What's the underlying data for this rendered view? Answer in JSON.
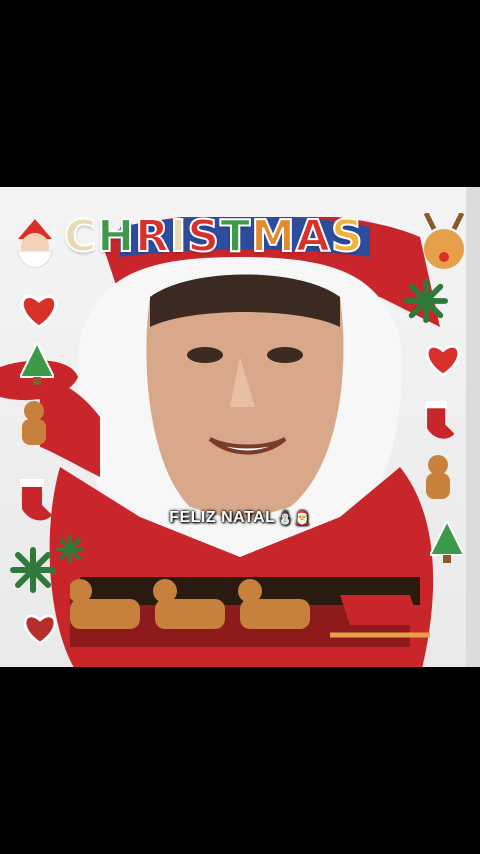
{
  "image": {
    "title_letters": [
      "C",
      "H",
      "R",
      "I",
      "S",
      "T",
      "M",
      "A",
      "S"
    ],
    "title_colors": [
      "#e9d9b6",
      "#3c9a4a",
      "#d8312c",
      "#e9d9b6",
      "#d8312c",
      "#3c9a4a",
      "#e58a2c",
      "#d8312c",
      "#f2b33b"
    ],
    "caption_text": "FELIZ NATAL",
    "caption_emoji": "⛄🎅",
    "watermark": "",
    "colors": {
      "santa_red": "#c8262a",
      "santa_dark_red": "#8e1a1c",
      "beard_white": "#f7f7f7",
      "hat_blue": "#2e4c9c",
      "skin": "#d9a88a",
      "background": "#efefef"
    },
    "decorations": [
      "santa-head-icon",
      "reindeer-head-icon",
      "heart-cookie-icon",
      "christmas-tree-icon",
      "gingerbread-man-icon",
      "stocking-icon",
      "snowflake-icon",
      "reindeer-row",
      "sleigh-icon",
      "mittens-icon"
    ]
  }
}
